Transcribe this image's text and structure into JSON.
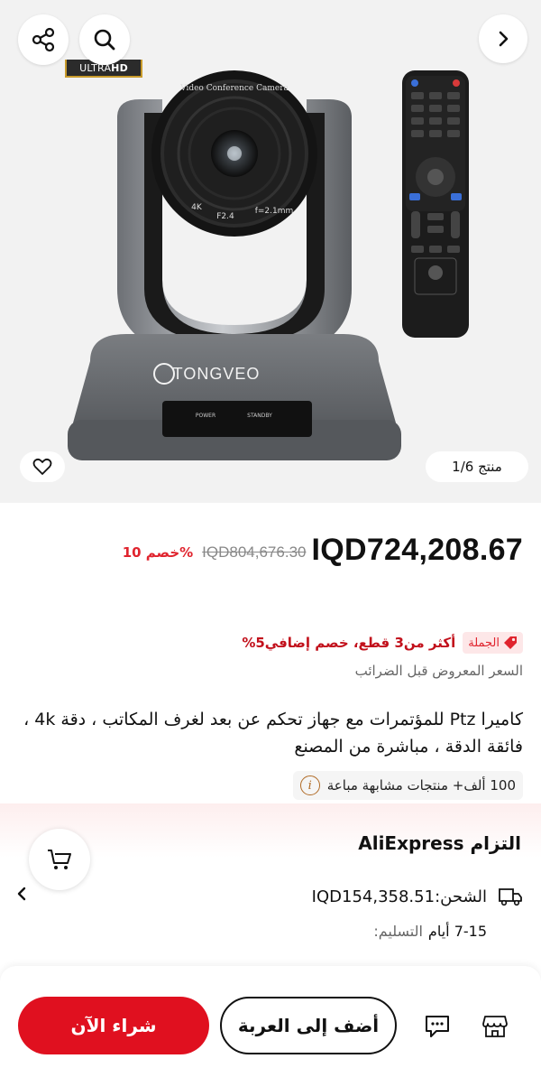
{
  "gallery": {
    "badge_ultra": "ULTRA",
    "badge_hd": "HD",
    "camera_label_top": "Video Conference Camera",
    "camera_spec_4k": "4K",
    "camera_spec_f": "F2.4",
    "camera_spec_focal": "f=2.1mm",
    "camera_brand": "TONGVEO",
    "camera_power": "POWER",
    "camera_standby": "STANDBY",
    "counter": "منتج 1/6",
    "icons": [
      "share-icon",
      "search-icon",
      "chevron-right-icon",
      "heart-icon"
    ]
  },
  "price": {
    "current": "IQD724,208.67",
    "original": "IQD804,676.30",
    "discount": "خصم 10%"
  },
  "bulk": {
    "tag": "الجملة",
    "text": "أكثر من3 قطع، خصم إضافي5%"
  },
  "tax_note": "السعر المعروض قبل الضرائب",
  "title": "كاميرا Ptz للمؤتمرات مع جهاز تحكم عن بعد لغرف المكاتب ، دقة 4k ، فائقة الدقة ، مباشرة من المصنع",
  "similar": {
    "text": "100 ألف+ منتجات مشابهة مباعة",
    "icon": "i"
  },
  "commitment": {
    "title": "التزام AliExpress",
    "shipping": "الشحن:IQD154,358.51",
    "delivery_label": "التسليم:",
    "delivery_value": "7-15 أيام"
  },
  "bottom_bar": {
    "buy_now": "شراء الآن",
    "add_to_cart": "أضف إلى العربة"
  },
  "colors": {
    "accent_red": "#e0101f",
    "price_red": "#e0242e",
    "badge_gold": "#c89b2c"
  }
}
